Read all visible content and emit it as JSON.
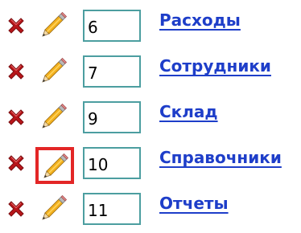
{
  "colors": {
    "link": "#1e3ec9",
    "input_border": "#4c9ea0",
    "delete_icon": "#b8161a",
    "selection_outline": "#e32626"
  },
  "icons": {
    "delete": "cross-icon",
    "edit": "pencil-icon"
  },
  "rows": [
    {
      "order": "6",
      "label": "Расходы"
    },
    {
      "order": "7",
      "label": "Сотрудники"
    },
    {
      "order": "9",
      "label": "Склад"
    },
    {
      "order": "10",
      "label": "Справочники",
      "edit_selected": true
    },
    {
      "order": "11",
      "label": "Отчеты"
    }
  ]
}
